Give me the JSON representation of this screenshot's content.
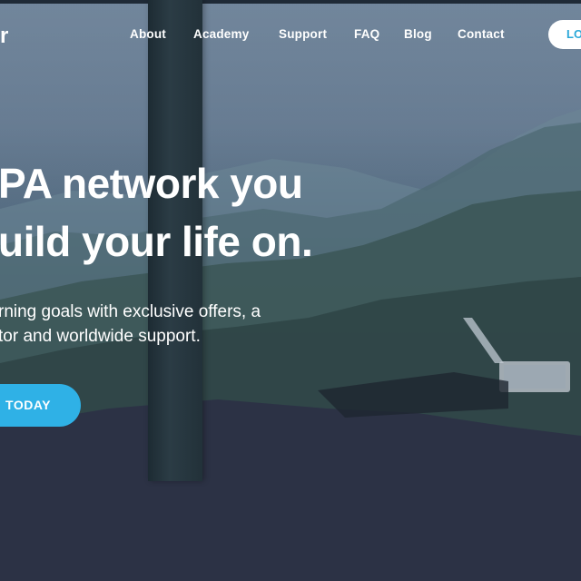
{
  "brand": {
    "logo_fragment": "r"
  },
  "nav": {
    "items": [
      {
        "label": "About"
      },
      {
        "label": "Academy"
      },
      {
        "label": "Support"
      },
      {
        "label": "FAQ"
      },
      {
        "label": "Blog"
      },
      {
        "label": "Contact"
      }
    ],
    "login_label": "LO"
  },
  "hero": {
    "headline_line1": "PA network you",
    "headline_line2": "uild your life on.",
    "subtext_line1": "rning goals with exclusive offers, a",
    "subtext_line2": "tor and worldwide support.",
    "cta_label": "TODAY"
  },
  "colors": {
    "accent": "#2fb1e6",
    "text": "#ffffff",
    "login_text": "#2aa8d8"
  }
}
